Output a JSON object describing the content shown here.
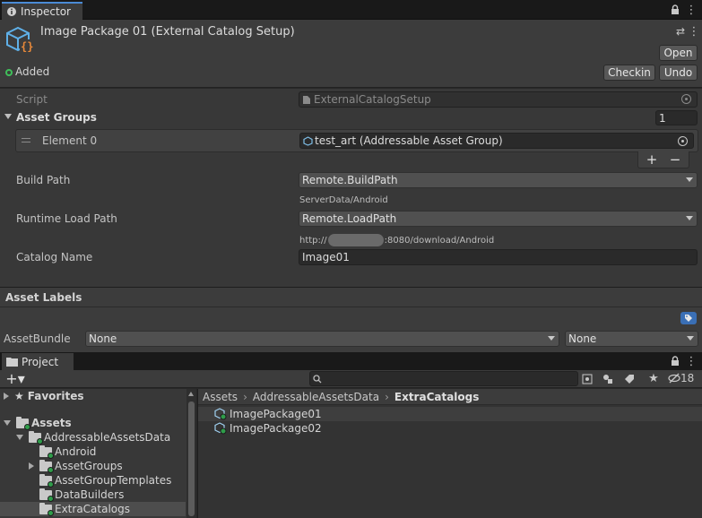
{
  "inspector": {
    "tab_label": "Inspector",
    "asset_title": "Image Package 01 (External Catalog Setup)",
    "status": "Added",
    "buttons": {
      "open": "Open",
      "checkin": "Checkin",
      "undo": "Undo"
    },
    "script_label": "Script",
    "script_value": "ExternalCatalogSetup",
    "asset_groups_label": "Asset Groups",
    "asset_groups_count": "1",
    "element_label": "Element 0",
    "element_value": "test_art (Addressable Asset Group)",
    "add_label": "+",
    "remove_label": "−",
    "build_path_label": "Build Path",
    "build_path_value": "Remote.BuildPath",
    "build_path_resolved": "ServerData/Android",
    "runtime_load_path_label": "Runtime Load Path",
    "runtime_load_path_value": "Remote.LoadPath",
    "runtime_load_prefix": "http://",
    "runtime_load_suffix": ":8080/download/Android",
    "catalog_name_label": "Catalog Name",
    "catalog_name_value": "Image01",
    "asset_labels": "Asset Labels",
    "asset_bundle_label": "AssetBundle",
    "asset_bundle_value": "None",
    "asset_bundle_variant": "None"
  },
  "project": {
    "tab_label": "Project",
    "hidden_count": "18",
    "favorites": "Favorites",
    "assets": "Assets",
    "tree": [
      "AddressableAssetsData",
      "Android",
      "AssetGroups",
      "AssetGroupTemplates",
      "DataBuilders",
      "ExtraCatalogs"
    ],
    "breadcrumb": [
      "Assets",
      "AddressableAssetsData",
      "ExtraCatalogs"
    ],
    "files": [
      "ImagePackage01",
      "ImagePackage02"
    ]
  },
  "colors": {
    "accent": "#4b8bd6",
    "added": "#3fbf5a",
    "label_tag": "#3a6fb5"
  }
}
